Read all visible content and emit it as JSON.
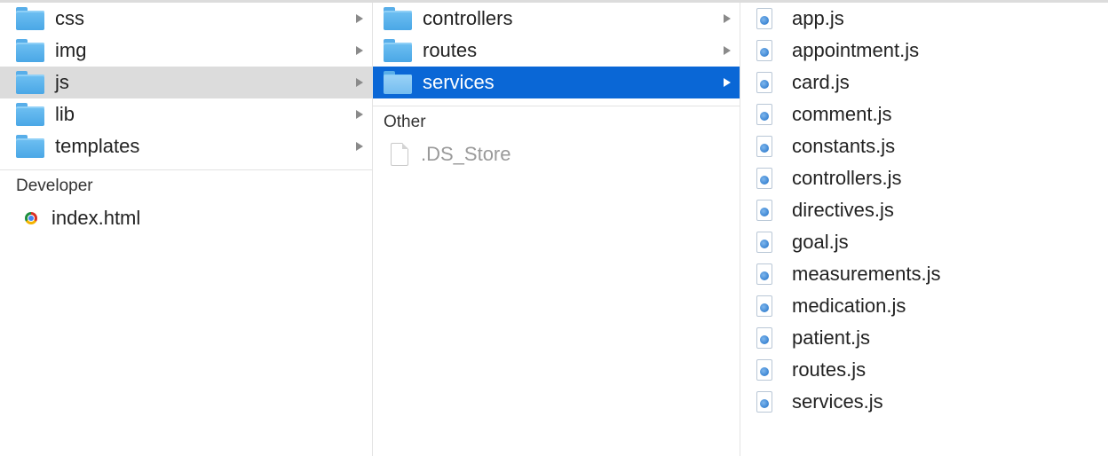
{
  "column1": {
    "folders": [
      {
        "label": "css"
      },
      {
        "label": "img"
      },
      {
        "label": "js"
      },
      {
        "label": "lib"
      },
      {
        "label": "templates"
      }
    ],
    "section_header": "Developer",
    "files": [
      {
        "label": "index.html",
        "icon": "chrome-html-icon"
      }
    ]
  },
  "column2": {
    "folders": [
      {
        "label": "controllers"
      },
      {
        "label": "routes"
      },
      {
        "label": "services"
      }
    ],
    "section_header": "Other",
    "files": [
      {
        "label": ".DS_Store",
        "icon": "document-icon"
      }
    ]
  },
  "column3": {
    "files": [
      {
        "label": "app.js"
      },
      {
        "label": "appointment.js"
      },
      {
        "label": "card.js"
      },
      {
        "label": "comment.js"
      },
      {
        "label": "constants.js"
      },
      {
        "label": "controllers.js"
      },
      {
        "label": "directives.js"
      },
      {
        "label": "goal.js"
      },
      {
        "label": "measurements.js"
      },
      {
        "label": "medication.js"
      },
      {
        "label": "patient.js"
      },
      {
        "label": "routes.js"
      },
      {
        "label": "services.js"
      }
    ]
  },
  "colors": {
    "selection_active": "#0a67d6",
    "selection_inactive": "#dcdcdc",
    "folder_blue": "#4aa7e6"
  }
}
